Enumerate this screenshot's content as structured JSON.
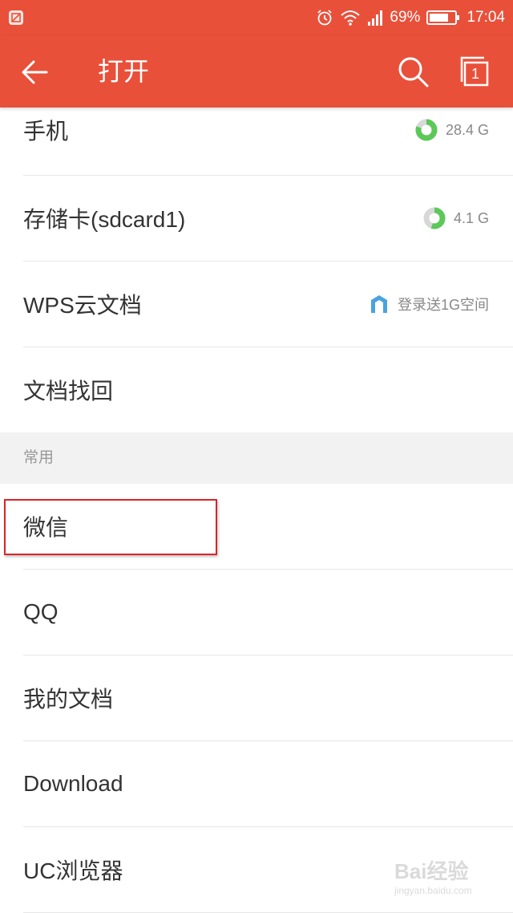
{
  "status_bar": {
    "battery": "69%",
    "time": "17:04",
    "icons": [
      "screenshot-icon",
      "alarm-icon",
      "wifi-icon",
      "signal-icon",
      "battery-icon"
    ]
  },
  "app_bar": {
    "title": "打开",
    "tab_count": "1",
    "background_color": "#e9503a",
    "icons": [
      "back-arrow-icon",
      "search-icon",
      "tabs-icon"
    ]
  },
  "storage": [
    {
      "label": "手机",
      "info": "28.4 G",
      "used_fraction": 0.8,
      "icon": "storage-pie-icon"
    },
    {
      "label": "存储卡(sdcard1)",
      "info": "4.1 G",
      "used_fraction": 0.55,
      "icon": "storage-pie-icon"
    },
    {
      "label": "WPS云文档",
      "info": "登录送1G空间",
      "icon": "wps-cloud-icon"
    },
    {
      "label": "文档找回"
    }
  ],
  "section_common": {
    "title": "常用",
    "items": [
      {
        "label": "微信"
      },
      {
        "label": "QQ"
      },
      {
        "label": "我的文档"
      },
      {
        "label": "Download"
      },
      {
        "label": "UC浏览器"
      }
    ]
  },
  "highlight_color": "#d9242b",
  "watermark": {
    "logo": "Bai经验",
    "url": "jingyan.baidu.com"
  }
}
